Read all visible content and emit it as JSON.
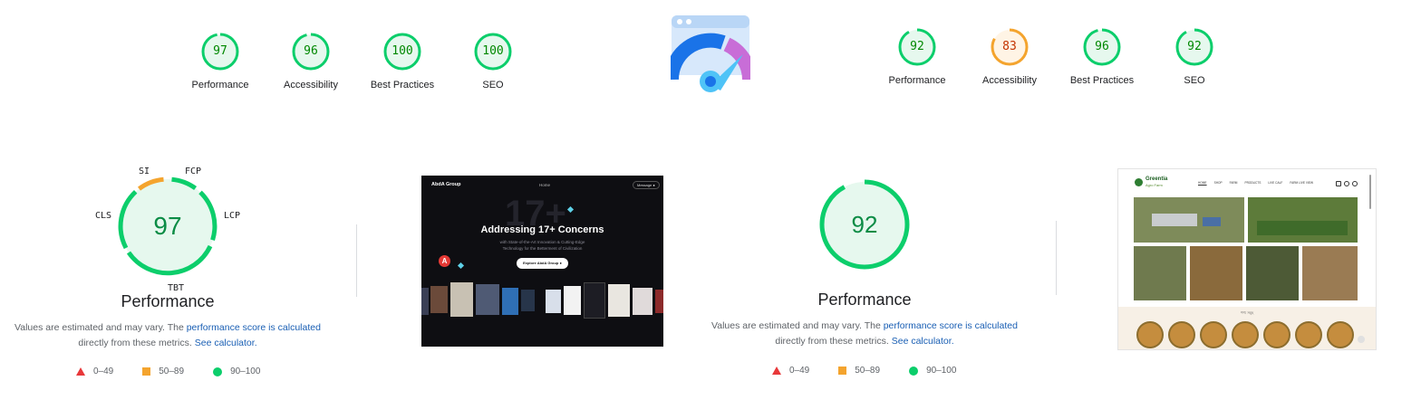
{
  "colors": {
    "pass": "#0cce6b",
    "pass_bg": "#e6f8ee",
    "pass_text": "#008800",
    "avg": "#f4a42e",
    "avg_bg": "#fff4e5",
    "avg_text": "#c33300",
    "fail": "#e8383a"
  },
  "left": {
    "scores": [
      {
        "label": "Performance",
        "value": "97",
        "rating": "pass"
      },
      {
        "label": "Accessibility",
        "value": "96",
        "rating": "pass"
      },
      {
        "label": "Best Practices",
        "value": "100",
        "rating": "pass"
      },
      {
        "label": "SEO",
        "value": "100",
        "rating": "pass"
      }
    ],
    "perf": {
      "score": "97",
      "title": "Performance",
      "metrics": {
        "si": "SI",
        "fcp": "FCP",
        "lcp": "LCP",
        "tbt": "TBT",
        "cls": "CLS"
      },
      "desc_pre": "Values are estimated and may vary. The ",
      "desc_link": "performance score is calculated",
      "desc_mid": "directly from these metrics. ",
      "desc_calc": "See calculator."
    },
    "screenshot": {
      "brand": "AbdA Group",
      "nav": "Home",
      "button": "Message ●",
      "big_bg": "17+",
      "headline": "Addressing 17+ Concerns",
      "sub1": "with State-of-the-Art Innovation & Cutting-Edge",
      "sub2": "Technology for the Betterment of Civilization",
      "cta": "Explore AbdA Group ●",
      "logo_letter": "A"
    }
  },
  "right": {
    "scores": [
      {
        "label": "Performance",
        "value": "92",
        "rating": "pass"
      },
      {
        "label": "Accessibility",
        "value": "83",
        "rating": "avg"
      },
      {
        "label": "Best Practices",
        "value": "96",
        "rating": "pass"
      },
      {
        "label": "SEO",
        "value": "92",
        "rating": "pass"
      }
    ],
    "perf": {
      "score": "92",
      "title": "Performance",
      "desc_pre": "Values are estimated and may vary. The ",
      "desc_link": "performance score is calculated",
      "desc_mid": "directly from these metrics. ",
      "desc_calc": "See calculator."
    },
    "screenshot": {
      "brand1": "Greentia",
      "brand2": "Agro Farm",
      "nav": [
        "HOME",
        "SHOP",
        "FARM",
        "PRODUCTS",
        "LIVE CALF",
        "FARM LIVE VIEW"
      ],
      "section": "পণ্য সমূহ"
    }
  },
  "legend": {
    "fail": "0–49",
    "average": "50–89",
    "pass": "90–100"
  }
}
